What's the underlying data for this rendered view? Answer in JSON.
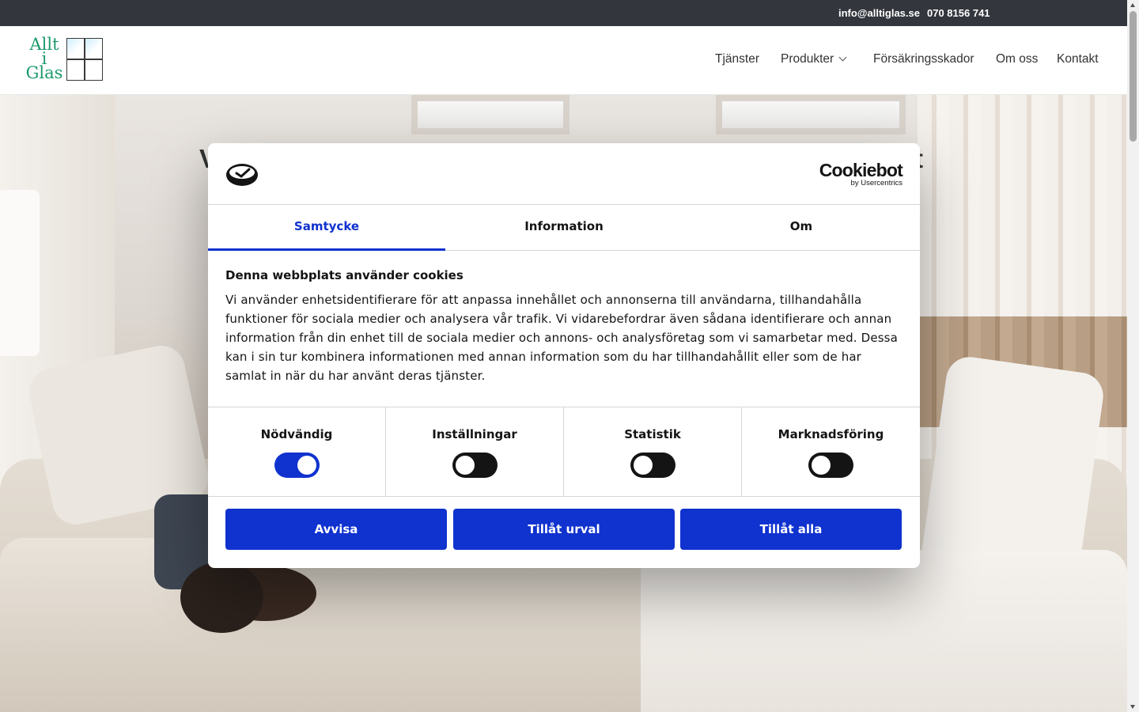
{
  "topbar": {
    "email": "info@alltiglas.se",
    "phone": "070 8156 741"
  },
  "logo": {
    "line1": "Allt",
    "line2": "i",
    "line3": "Glas"
  },
  "nav": {
    "items": [
      {
        "label": "Tjänster"
      },
      {
        "label": "Produkter"
      },
      {
        "label": "Försäkringsskador"
      },
      {
        "label": "Om oss"
      },
      {
        "label": "Kontakt"
      }
    ]
  },
  "hero": {
    "heading_left": "V",
    "heading_right": "t"
  },
  "cookie": {
    "brand": "Cookiebot",
    "brand_sub": "by Usercentrics",
    "tabs": [
      {
        "label": "Samtycke",
        "active": true
      },
      {
        "label": "Information",
        "active": false
      },
      {
        "label": "Om",
        "active": false
      }
    ],
    "title": "Denna webbplats använder cookies",
    "text": "Vi använder enhetsidentifierare för att anpassa innehållet och annonserna till användarna, tillhandahålla funktioner för sociala medier och analysera vår trafik. Vi vidarebefordrar även sådana identifierare och annan information från din enhet till de sociala medier och annons- och analysföretag som vi samarbetar med. Dessa kan i sin tur kombinera informationen med annan information som du har tillhandahållit eller som de har samlat in när du har använt deras tjänster.",
    "categories": [
      {
        "label": "Nödvändig",
        "enabled": true
      },
      {
        "label": "Inställningar",
        "enabled": false
      },
      {
        "label": "Statistik",
        "enabled": false
      },
      {
        "label": "Marknadsföring",
        "enabled": false
      }
    ],
    "buttons": {
      "reject": "Avvisa",
      "allow_selection": "Tillåt urval",
      "allow_all": "Tillåt alla"
    }
  },
  "colors": {
    "accent": "#1032cf",
    "topbar_bg": "#33373d",
    "logo_green": "#1b9a6b"
  }
}
